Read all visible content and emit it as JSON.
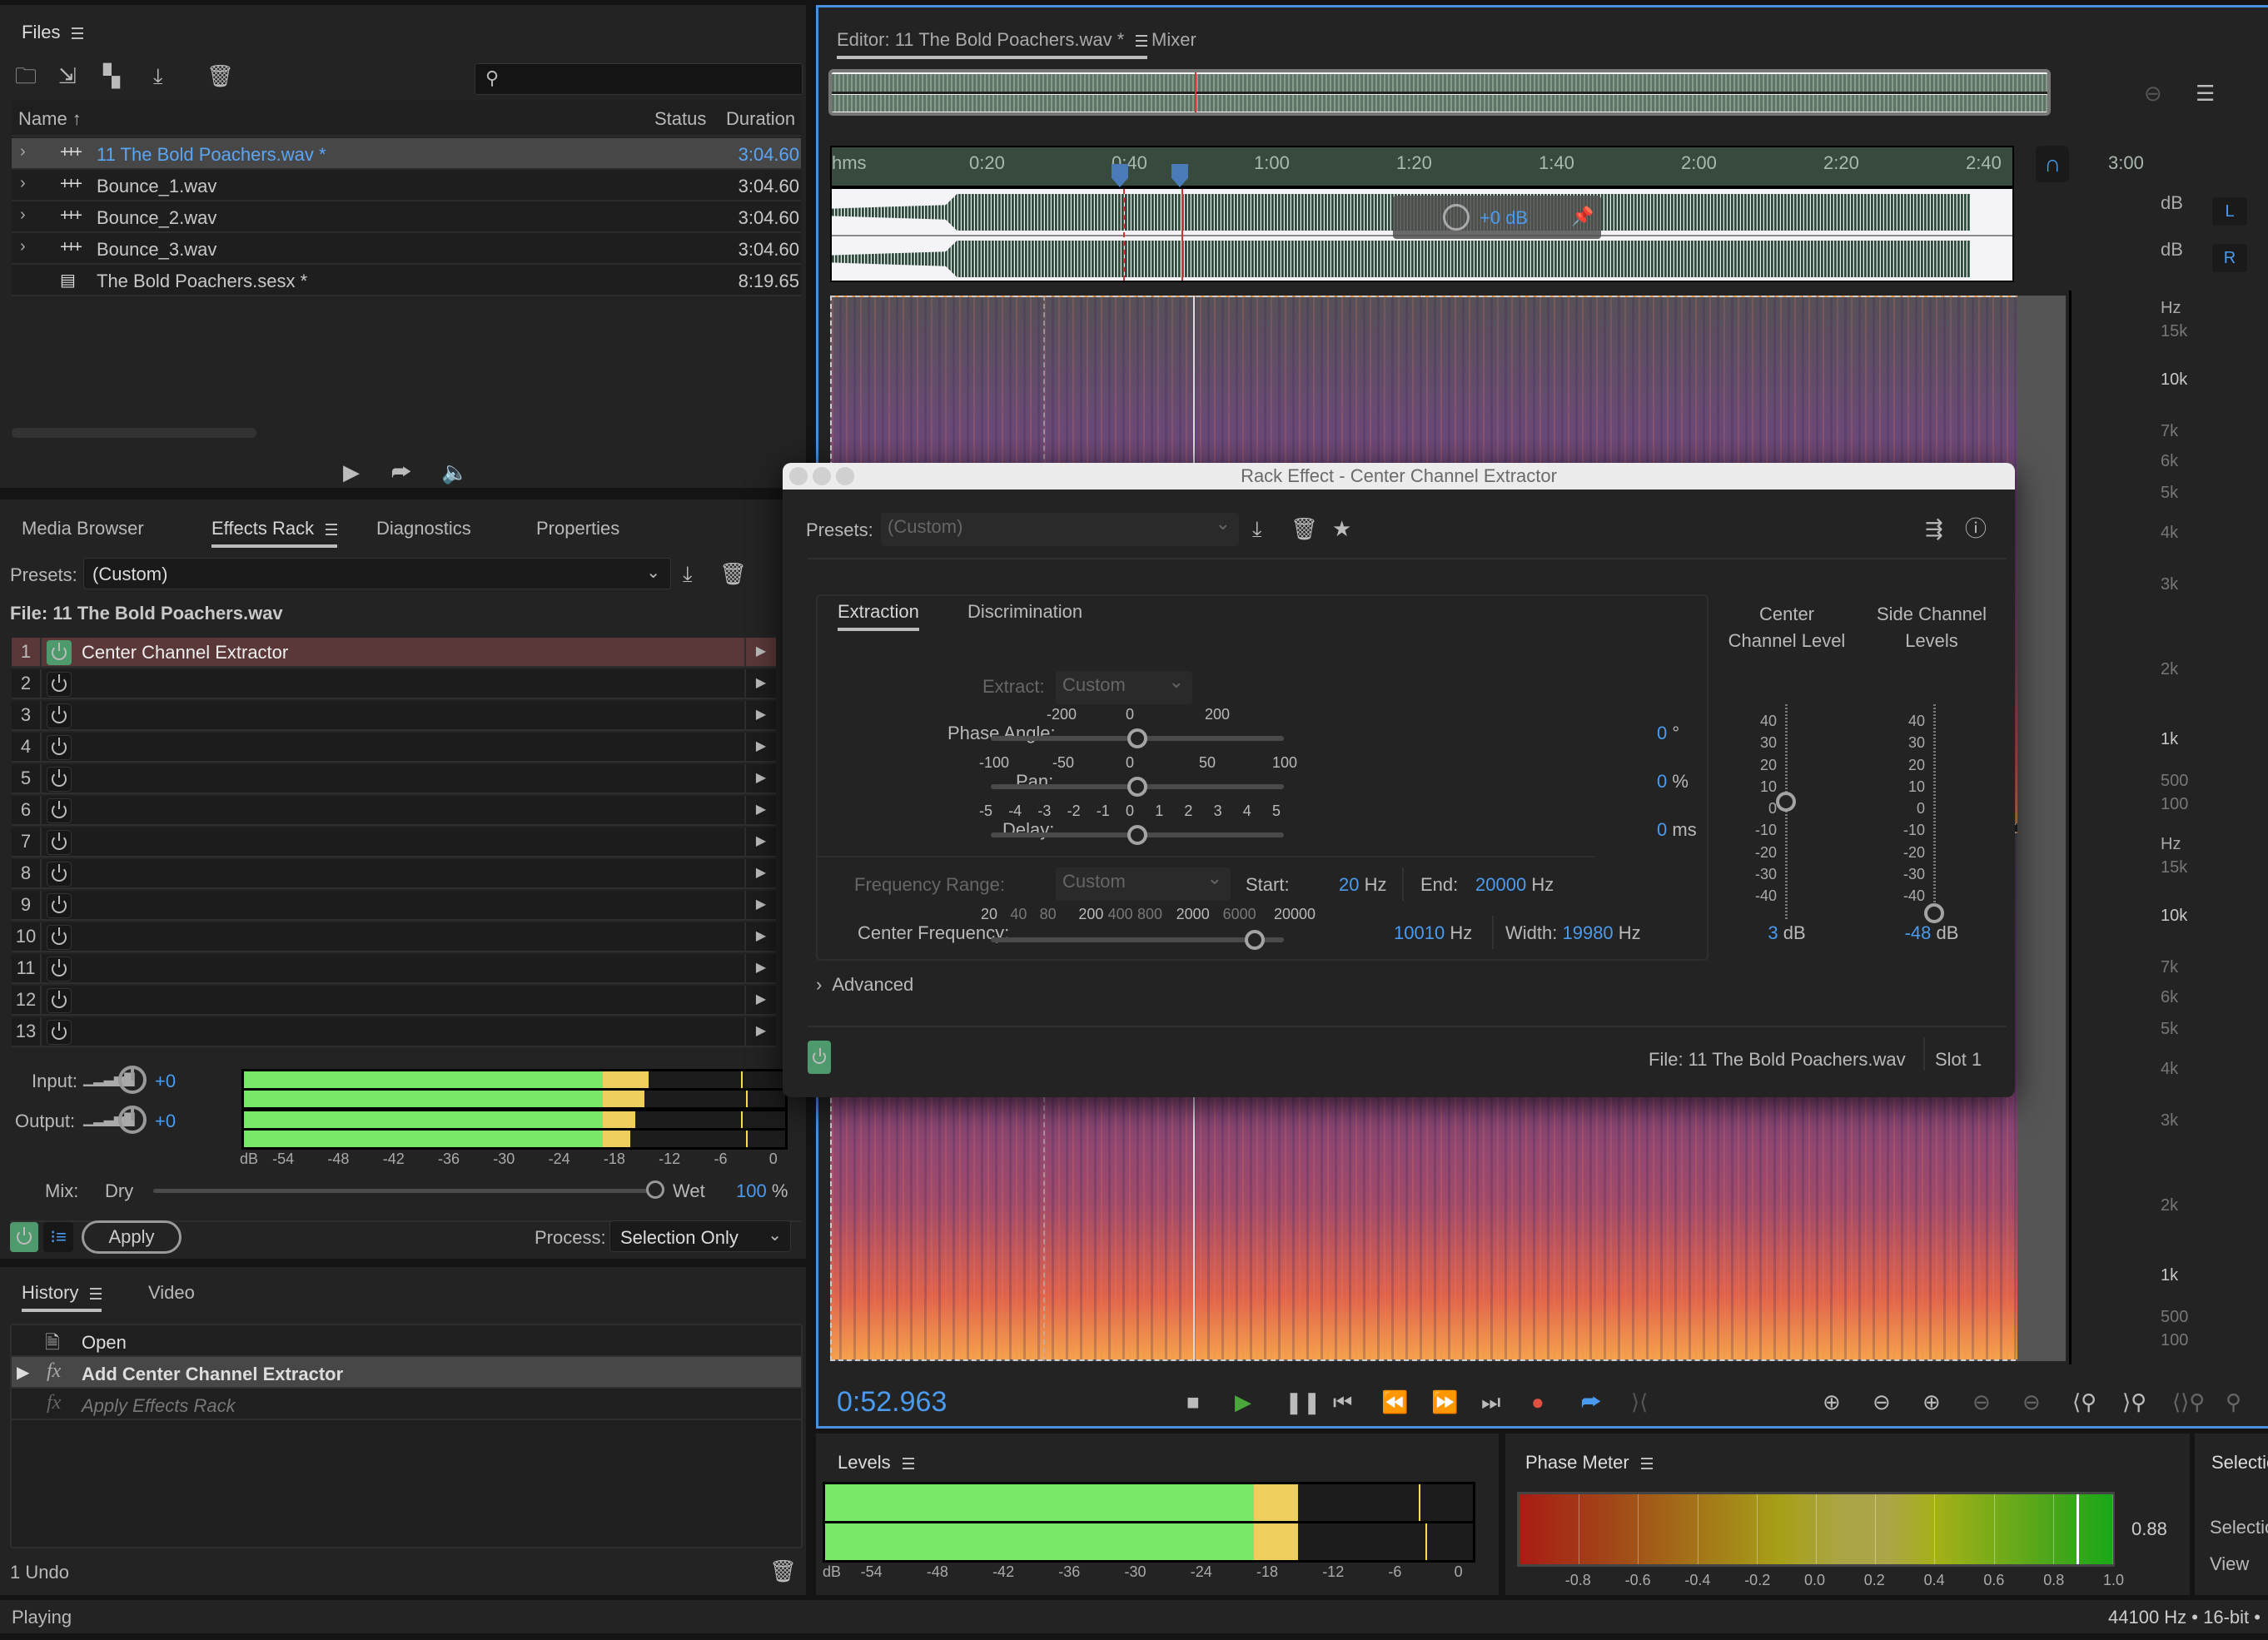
{
  "files_panel": {
    "title": "Files",
    "columns": {
      "name": "Name ↑",
      "status": "Status",
      "duration": "Duration"
    },
    "files": [
      {
        "name": "11 The Bold Poachers.wav *",
        "duration": "3:04.60",
        "type": "waveform",
        "selected": true
      },
      {
        "name": "Bounce_1.wav",
        "duration": "3:04.60",
        "type": "waveform"
      },
      {
        "name": "Bounce_2.wav",
        "duration": "3:04.60",
        "type": "waveform"
      },
      {
        "name": "Bounce_3.wav",
        "duration": "3:04.60",
        "type": "waveform"
      },
      {
        "name": "The Bold Poachers.sesx *",
        "duration": "8:19.65",
        "type": "session"
      }
    ],
    "search_placeholder": ""
  },
  "rack_panel": {
    "tabs": [
      "Media Browser",
      "Effects Rack",
      "Diagnostics",
      "Properties"
    ],
    "active_tab": "Effects Rack",
    "presets_label": "Presets:",
    "preset_value": "(Custom)",
    "file_label": "File: 11 The Bold Poachers.wav",
    "slots": [
      {
        "n": "1",
        "name": "Center Channel Extractor",
        "on": true
      },
      {
        "n": "2",
        "name": ""
      },
      {
        "n": "3",
        "name": ""
      },
      {
        "n": "4",
        "name": ""
      },
      {
        "n": "5",
        "name": ""
      },
      {
        "n": "6",
        "name": ""
      },
      {
        "n": "7",
        "name": ""
      },
      {
        "n": "8",
        "name": ""
      },
      {
        "n": "9",
        "name": ""
      },
      {
        "n": "10",
        "name": ""
      },
      {
        "n": "11",
        "name": ""
      },
      {
        "n": "12",
        "name": ""
      },
      {
        "n": "13",
        "name": ""
      }
    ],
    "input_label": "Input:",
    "input_gain": "+0",
    "output_label": "Output:",
    "output_gain": "+0",
    "meter_scale": [
      "dB",
      "-54",
      "-48",
      "-42",
      "-36",
      "-30",
      "-24",
      "-18",
      "-12",
      "-6",
      "0"
    ],
    "input_levels_db": [
      -13,
      -13.5
    ],
    "output_levels_db": [
      -14.5,
      -15
    ],
    "mix_label": "Mix:",
    "dry_label": "Dry",
    "wet_label": "Wet",
    "mix_value": "100",
    "mix_unit": "%",
    "apply_label": "Apply",
    "process_label": "Process:",
    "process_value": "Selection Only"
  },
  "history_panel": {
    "tabs": [
      "History",
      "Video"
    ],
    "items": [
      {
        "label": "Open",
        "icon": "open-file-icon"
      },
      {
        "label": "Add Center Channel Extractor",
        "icon": "fx-icon",
        "current": true
      },
      {
        "label": "Apply Effects Rack",
        "icon": "fx-icon",
        "undone": true
      }
    ],
    "undo_count": "1 Undo"
  },
  "status_bar": {
    "left": "Playing",
    "right": "44100 Hz • 16-bit •"
  },
  "editor": {
    "tab_label": "Editor: 11 The Bold Poachers.wav *",
    "mixer_label": "Mixer",
    "timeline_labels": [
      "hms",
      "0:20",
      "0:40",
      "1:00",
      "1:20",
      "1:40",
      "2:00",
      "2:20",
      "2:40",
      "3:00"
    ],
    "hud_gain": "+0 dB",
    "channel_labels": [
      "L",
      "R"
    ],
    "amp_unit": "dB",
    "freq_unit": "Hz",
    "freq_labels": [
      "15k",
      "10k",
      "7k",
      "6k",
      "5k",
      "4k",
      "3k",
      "2k",
      "1k",
      "500",
      "100"
    ],
    "current_time": "0:52.963"
  },
  "levels_panel": {
    "title": "Levels",
    "scale": [
      "dB",
      "-54",
      "-48",
      "-42",
      "-36",
      "-30",
      "-24",
      "-18",
      "-12",
      "-6",
      "0"
    ],
    "levels_db": [
      -14,
      -14
    ]
  },
  "phase_panel": {
    "title": "Phase Meter",
    "scale": [
      "-0.8",
      "-0.6",
      "-0.4",
      "-0.2",
      "0.0",
      "0.2",
      "0.4",
      "0.6",
      "0.8",
      "1.0"
    ],
    "value": "0.88"
  },
  "selection_panel": {
    "title": "Selectio",
    "rows": [
      "Selectio",
      "View"
    ]
  },
  "dialog": {
    "title": "Rack Effect - Center Channel Extractor",
    "presets_label": "Presets:",
    "preset_value": "(Custom)",
    "tabs": [
      "Extraction",
      "Discrimination"
    ],
    "extract_label": "Extract:",
    "extract_value": "Custom",
    "phase_label": "Phase Angle:",
    "phase_ticks": [
      "-200",
      "0",
      "200"
    ],
    "phase_value": "0",
    "phase_unit": "°",
    "pan_label": "Pan:",
    "pan_ticks": [
      "-100",
      "-50",
      "0",
      "50",
      "100"
    ],
    "pan_value": "0",
    "pan_unit": "%",
    "delay_label": "Delay:",
    "delay_ticks": [
      "-5",
      "-4",
      "-3",
      "-2",
      "-1",
      "0",
      "1",
      "2",
      "3",
      "4",
      "5"
    ],
    "delay_value": "0",
    "delay_unit": "ms",
    "freq_range_label": "Frequency Range:",
    "freq_range_value": "Custom",
    "start_label": "Start:",
    "start_value": "20",
    "start_unit": "Hz",
    "end_label": "End:",
    "end_value": "20000",
    "end_unit": "Hz",
    "center_freq_label": "Center Frequency:",
    "center_freq_ticks": [
      "20",
      "40",
      "80",
      "200",
      "400",
      "800",
      "2000",
      "6000",
      "20000"
    ],
    "center_freq_value": "10010",
    "center_freq_unit": "Hz",
    "width_label": "Width:",
    "width_value": "19980",
    "width_unit": "Hz",
    "center_level_title_1": "Center",
    "center_level_title_2": "Channel Level",
    "side_level_title_1": "Side Channel",
    "side_level_title_2": "Levels",
    "level_scale": [
      "40",
      "30",
      "20",
      "10",
      "0",
      "-10",
      "-20",
      "-30",
      "-40"
    ],
    "center_level_value": "3",
    "side_level_value": "-48",
    "level_unit": "dB",
    "advanced_label": "Advanced",
    "footer_file": "File: 11 The Bold Poachers.wav",
    "footer_slot": "Slot 1"
  }
}
